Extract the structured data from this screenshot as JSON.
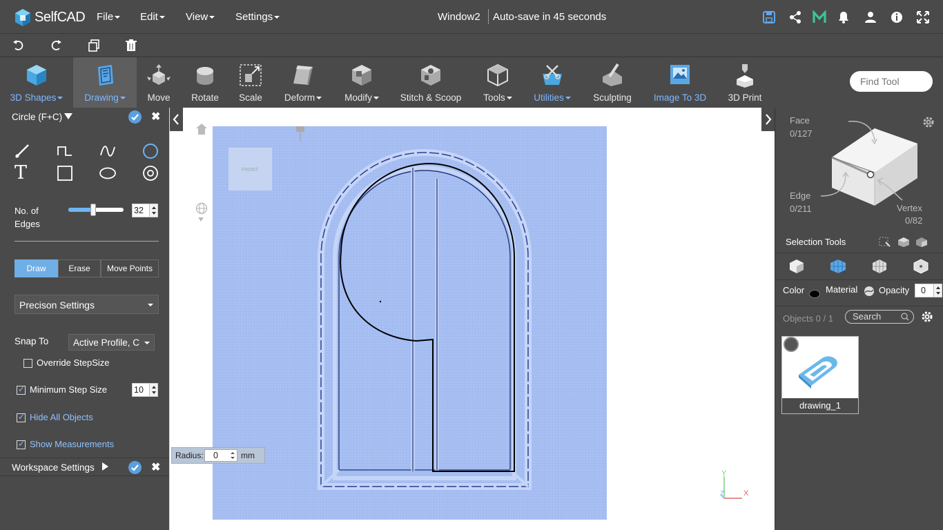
{
  "app": {
    "logo_text": "SelfCAD",
    "menus": [
      "File",
      "Edit",
      "View",
      "Settings"
    ],
    "window_title": "Window2",
    "autosave": "Auto-save in 45 seconds"
  },
  "toolbar": {
    "tools": [
      {
        "label": "3D Shapes",
        "icon": "cube-icon"
      },
      {
        "label": "Drawing",
        "icon": "drawing-icon"
      },
      {
        "label": "Move",
        "icon": "move-icon"
      },
      {
        "label": "Rotate",
        "icon": "rotate-icon"
      },
      {
        "label": "Scale",
        "icon": "scale-icon"
      },
      {
        "label": "Deform",
        "icon": "deform-icon"
      },
      {
        "label": "Modify",
        "icon": "modify-icon"
      },
      {
        "label": "Stitch & Scoop",
        "icon": "stitch-icon"
      },
      {
        "label": "Tools",
        "icon": "tools-icon"
      },
      {
        "label": "Utilities",
        "icon": "utilities-icon"
      },
      {
        "label": "Sculpting",
        "icon": "sculpting-icon"
      },
      {
        "label": "Image To 3D",
        "icon": "image-to-3d-icon"
      },
      {
        "label": "3D Print",
        "icon": "3d-print-icon"
      }
    ],
    "find_placeholder": "Find Tool"
  },
  "left_panel": {
    "title": "Circle (F+C)",
    "edges_label_1": "No. of",
    "edges_label_2": "Edges",
    "edges_value": "32",
    "modes": [
      "Draw",
      "Erase",
      "Move Points"
    ],
    "precision": "Precison Settings",
    "snap_label": "Snap To",
    "snap_value": "Active Profile, C",
    "override": "Override StepSize",
    "min_step": "Minimum Step Size",
    "min_step_value": "10",
    "hide_all": "Hide All Objects",
    "show_meas": "Show Measurements",
    "workspace": "Workspace Settings"
  },
  "viewport": {
    "radius_label": "Radius:",
    "radius_value": "0",
    "radius_unit": "mm",
    "cube_face": "FRONT",
    "axis_x": "X",
    "axis_y": "Y",
    "axis_z": "Z"
  },
  "right_panel": {
    "face_label": "Face",
    "face_count": "0/127",
    "edge_label": "Edge",
    "edge_count": "0/211",
    "vertex_label": "Vertex",
    "vertex_count": "0/82",
    "selection_tools": "Selection Tools",
    "color_label": "Color",
    "material_label": "Material",
    "opacity_label": "Opacity",
    "opacity_value": "0",
    "objects_label": "Objects 0 / 1",
    "search_placeholder": "Search",
    "object_name": "drawing_1"
  },
  "colors": {
    "accent": "#5b9fe0",
    "panel": "#4a4a4a",
    "grid": "#a9c0f2"
  }
}
